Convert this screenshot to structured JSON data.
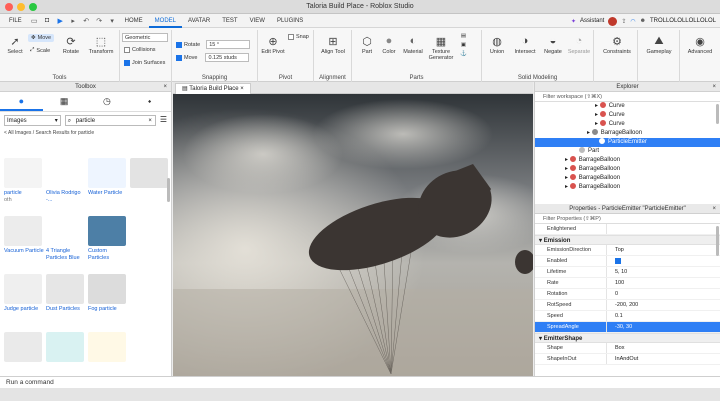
{
  "window": {
    "title": "Taloria Build Place - Roblox Studio"
  },
  "menubar": {
    "tabs": [
      "FILE",
      "HOME",
      "MODEL",
      "AVATAR",
      "TEST",
      "VIEW",
      "PLUGINS"
    ],
    "active_tab": "MODEL",
    "assistant": "Assistant",
    "username": "TROLLOLOLLOLLOLOL"
  },
  "ribbon": {
    "select": "Select",
    "move": "Move",
    "scale": "Scale",
    "rotate": "Rotate",
    "transform": "Transform",
    "tools_label": "Tools",
    "mode": "Geometric",
    "collisions": "Collisions",
    "join_surfaces": "Join Surfaces",
    "rotate_label": "Rotate",
    "rotate_value": "15 °",
    "move_label": "Move",
    "move_value": "0.125 studs",
    "snapping_label": "Snapping",
    "edit_pivot": "Edit Pivot",
    "snap": "Snap",
    "pivot_label": "Pivot",
    "align_tool": "Align Tool",
    "alignment_label": "Alignment",
    "part": "Part",
    "color": "Color",
    "material": "Material",
    "texture_generator": "Texture Generator",
    "parts_label": "Parts",
    "union": "Union",
    "intersect": "Intersect",
    "negate": "Negate",
    "separate": "Separate",
    "solid_modeling_label": "Solid Modeling",
    "constraints": "Constraints",
    "gameplay": "Gameplay",
    "advanced": "Advanced"
  },
  "toolbox": {
    "title": "Toolbox",
    "category": "Images",
    "search_value": "particle",
    "breadcrumb": "< All Images / Search Results for particle",
    "items": [
      {
        "label": "particle",
        "sub": "oth",
        "color": "#f4f4f4"
      },
      {
        "label": "Olivia Rodrigo -...",
        "sub": "",
        "color": "#ffffff"
      },
      {
        "label": "Water Particle",
        "sub": "",
        "color": "#eef5ff"
      },
      {
        "label": "",
        "sub": "",
        "color": "#e3e3e3"
      },
      {
        "label": "Vacuum Particle",
        "sub": "",
        "color": "#ececec"
      },
      {
        "label": "4 Triangle Particles Blue",
        "sub": "",
        "color": "#ffffff"
      },
      {
        "label": "Custom Particles",
        "sub": "",
        "color": "#4d7fa6"
      },
      {
        "label": "",
        "sub": "",
        "color": "#ffffff"
      },
      {
        "label": "Judge particle",
        "sub": "",
        "color": "#efefef"
      },
      {
        "label": "Dust Particles",
        "sub": "",
        "color": "#e6e6e6"
      },
      {
        "label": "Fog particle",
        "sub": "",
        "color": "#dcdcdc"
      },
      {
        "label": "",
        "sub": "",
        "color": "#ffffff"
      },
      {
        "label": "",
        "sub": "",
        "color": "#eaeaea"
      },
      {
        "label": "",
        "sub": "",
        "color": "#d9f2f2"
      },
      {
        "label": "",
        "sub": "",
        "color": "#fff9e6"
      }
    ]
  },
  "viewport": {
    "tab": "Taloria Build Place"
  },
  "explorer": {
    "title": "Explorer",
    "filter": "Filter workspace (⇧⌘X)",
    "rows": [
      {
        "label": "Curve",
        "indent": 60,
        "color": "#d9534f",
        "arrow": true
      },
      {
        "label": "Curve",
        "indent": 60,
        "color": "#d9534f",
        "arrow": true
      },
      {
        "label": "Curve",
        "indent": 60,
        "color": "#d9534f",
        "arrow": true
      },
      {
        "label": "BarrageBalloon",
        "indent": 52,
        "color": "#8a8a8a",
        "arrow": true
      },
      {
        "label": "ParticleEmitter",
        "indent": 64,
        "color": "#ffffff",
        "arrow": false,
        "selected": true
      },
      {
        "label": "Part",
        "indent": 44,
        "color": "#bbbbbb",
        "arrow": false
      },
      {
        "label": "BarrageBalloon",
        "indent": 30,
        "color": "#d9534f",
        "arrow": true
      },
      {
        "label": "BarrageBalloon",
        "indent": 30,
        "color": "#d9534f",
        "arrow": true
      },
      {
        "label": "BarrageBalloon",
        "indent": 30,
        "color": "#d9534f",
        "arrow": true
      },
      {
        "label": "BarrageBalloon",
        "indent": 30,
        "color": "#d9534f",
        "arrow": true
      }
    ]
  },
  "properties": {
    "title": "Properties - ParticleEmitter \"ParticleEmitter\"",
    "filter": "Filter Properties (⇧⌘P)",
    "top_row": {
      "name": "Enlightened",
      "value": ""
    },
    "section": "Emission",
    "rows": [
      {
        "name": "EmissionDirection",
        "value": "Top"
      },
      {
        "name": "Enabled",
        "value": "",
        "checkbox": true
      },
      {
        "name": "Lifetime",
        "value": "5, 10"
      },
      {
        "name": "Rate",
        "value": "100"
      },
      {
        "name": "Rotation",
        "value": "0"
      },
      {
        "name": "RotSpeed",
        "value": "-200, 200"
      },
      {
        "name": "Speed",
        "value": "0.1"
      },
      {
        "name": "SpreadAngle",
        "value": "-30, 30",
        "selected": true
      }
    ],
    "section2": "EmitterShape",
    "rows2": [
      {
        "name": "Shape",
        "value": "Box"
      },
      {
        "name": "ShapeInOut",
        "value": "InAndOut"
      }
    ]
  },
  "command_bar": {
    "placeholder": "Run a command"
  }
}
